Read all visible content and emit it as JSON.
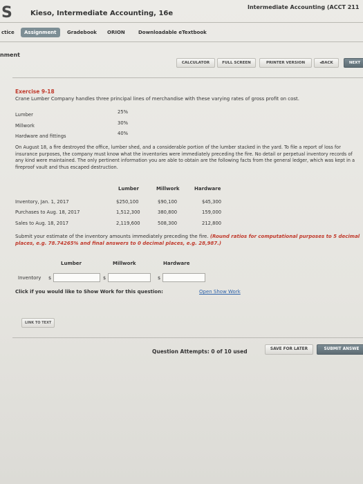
{
  "header": {
    "logo": "S",
    "book_title": "Kieso, Intermediate Accounting, 16e",
    "course_title": "Intermediate Accounting (ACCT 211"
  },
  "nav": {
    "items": [
      "ctice",
      "Assignment",
      "Gradebook",
      "ORION",
      "Downloadable eTextbook"
    ],
    "active": "Assignment"
  },
  "section_label": "nment",
  "toolbar": {
    "calculator": "CALCULATOR",
    "full_screen": "FULL SCREEN",
    "printer_version": "PRINTER VERSION",
    "back": "BACK",
    "next": "NEXT"
  },
  "exercise": {
    "title": "Exercise 9-18",
    "description": "Crane Lumber Company handles three principal lines of merchandise with these varying rates of gross profit on cost.",
    "lines": [
      {
        "name": "Lumber",
        "rate": "25%"
      },
      {
        "name": "Millwork",
        "rate": "30%"
      },
      {
        "name": "Hardware and fittings",
        "rate": "40%"
      }
    ],
    "paragraph": "On August 18, a fire destroyed the office, lumber shed, and a considerable portion of the lumber stacked in the yard. To file a report of loss for insurance purposes, the company must know what the inventories were immediately preceding the fire. No detail or perpetual inventory records of any kind were maintained. The only pertinent information you are able to obtain are the following facts from the general ledger, which was kept in a fireproof vault and thus escaped destruction.",
    "table": {
      "headers": [
        "Lumber",
        "Millwork",
        "Hardware"
      ],
      "rows": [
        {
          "label": "Inventory, Jan. 1, 2017",
          "values": [
            "$250,100",
            "$90,100",
            "$45,300"
          ]
        },
        {
          "label": "Purchases to Aug. 18, 2017",
          "values": [
            "1,512,300",
            "380,800",
            "159,000"
          ]
        },
        {
          "label": "Sales to Aug. 18, 2017",
          "values": [
            "2,119,600",
            "508,300",
            "212,800"
          ]
        }
      ]
    },
    "submit_plain": "Submit your estimate of the inventory amounts immediately preceding the fire.",
    "submit_red": "(Round ratios for computational purposes to 5 decimal places, e.g. 78.74265% and final answers to 0 decimal places, e.g. 28,987.)",
    "answer_headers": [
      "Lumber",
      "Millwork",
      "Hardware"
    ],
    "answer_label": "Inventory",
    "currency": "$",
    "answer_values": [
      "",
      "",
      ""
    ],
    "show_work_text": "Click if you would like to Show Work for this question:",
    "show_work_link": "Open Show Work",
    "link_to_text": "LINK TO TEXT"
  },
  "footer": {
    "attempts": "Question Attempts: 0 of 10 used",
    "save_later": "SAVE FOR LATER",
    "submit_answer": "SUBMIT ANSWE"
  }
}
